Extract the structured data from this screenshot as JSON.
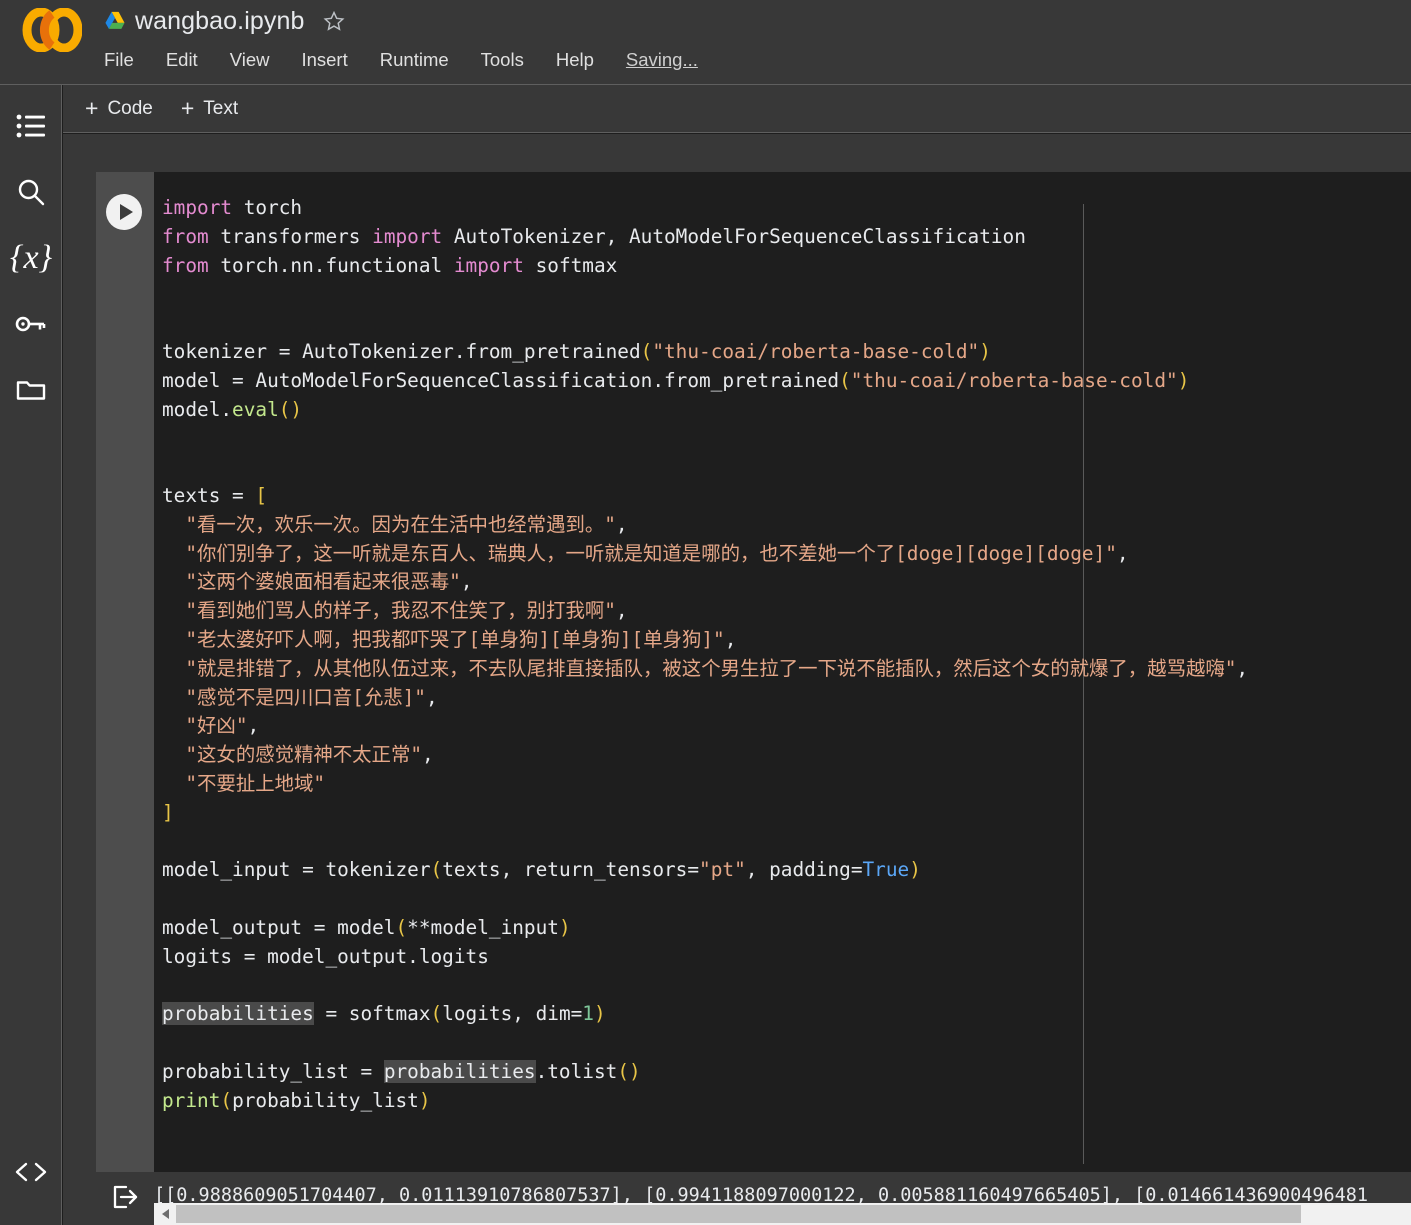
{
  "header": {
    "logo": "colab-logo",
    "drive_icon": "google-drive-icon",
    "notebook_title": "wangbao.ipynb",
    "star_icon": "star-icon",
    "menus": [
      "File",
      "Edit",
      "View",
      "Insert",
      "Runtime",
      "Tools",
      "Help"
    ],
    "save_status": "Saving..."
  },
  "rail": {
    "items": [
      {
        "name": "toc-icon",
        "label": "Table of contents"
      },
      {
        "name": "search-icon",
        "label": "Find and replace"
      },
      {
        "name": "variables-icon",
        "label": "{x}"
      },
      {
        "name": "key-icon",
        "label": "Secrets"
      },
      {
        "name": "folder-icon",
        "label": "Files"
      }
    ],
    "snippets_icon": "code-brackets-icon"
  },
  "toolbar": {
    "add_code_label": "Code",
    "add_text_label": "Text",
    "plus": "+"
  },
  "cell": {
    "run_icon": "run-play-icon",
    "output_icon": "output-arrow-icon",
    "code_lines": [
      {
        "type": "code",
        "tokens": [
          {
            "t": "import",
            "c": "kw"
          },
          {
            "t": " torch",
            "c": ""
          }
        ]
      },
      {
        "type": "code",
        "tokens": [
          {
            "t": "from",
            "c": "kw"
          },
          {
            "t": " transformers ",
            "c": ""
          },
          {
            "t": "import",
            "c": "kw"
          },
          {
            "t": " AutoTokenizer, AutoModelForSequenceClassification",
            "c": ""
          }
        ]
      },
      {
        "type": "code",
        "tokens": [
          {
            "t": "from",
            "c": "kw"
          },
          {
            "t": " torch.nn.functional ",
            "c": ""
          },
          {
            "t": "import",
            "c": "kw"
          },
          {
            "t": " softmax",
            "c": ""
          }
        ]
      },
      {
        "type": "blank",
        "tokens": []
      },
      {
        "type": "blank",
        "tokens": []
      },
      {
        "type": "code",
        "tokens": [
          {
            "t": "tokenizer = AutoTokenizer.from_pretrained",
            "c": ""
          },
          {
            "t": "(",
            "c": "par"
          },
          {
            "t": "\"thu-coai/roberta-base-cold\"",
            "c": "str"
          },
          {
            "t": ")",
            "c": "par"
          }
        ]
      },
      {
        "type": "code",
        "tokens": [
          {
            "t": "model = AutoModelForSequenceClassification.from_pretrained",
            "c": ""
          },
          {
            "t": "(",
            "c": "par"
          },
          {
            "t": "\"thu-coai/roberta-base-cold\"",
            "c": "str"
          },
          {
            "t": ")",
            "c": "par"
          }
        ]
      },
      {
        "type": "code",
        "tokens": [
          {
            "t": "model.",
            "c": ""
          },
          {
            "t": "eval",
            "c": "fn"
          },
          {
            "t": "()",
            "c": "par"
          }
        ]
      },
      {
        "type": "blank",
        "tokens": []
      },
      {
        "type": "blank",
        "tokens": []
      },
      {
        "type": "code",
        "tokens": [
          {
            "t": "texts = ",
            "c": ""
          },
          {
            "t": "[",
            "c": "par"
          }
        ]
      },
      {
        "type": "code",
        "tokens": [
          {
            "t": "  ",
            "c": ""
          },
          {
            "t": "\"看一次，欢乐一次。因为在生活中也经常遇到。\"",
            "c": "str"
          },
          {
            "t": ",",
            "c": ""
          }
        ]
      },
      {
        "type": "code",
        "tokens": [
          {
            "t": "  ",
            "c": ""
          },
          {
            "t": "\"你们别争了，这一听就是东百人、瑞典人，一听就是知道是哪的，也不差她一个了[doge][doge][doge]\"",
            "c": "str"
          },
          {
            "t": ",",
            "c": ""
          }
        ]
      },
      {
        "type": "code",
        "tokens": [
          {
            "t": "  ",
            "c": ""
          },
          {
            "t": "\"这两个婆娘面相看起来很恶毒\"",
            "c": "str"
          },
          {
            "t": ",",
            "c": ""
          }
        ]
      },
      {
        "type": "code",
        "tokens": [
          {
            "t": "  ",
            "c": ""
          },
          {
            "t": "\"看到她们骂人的样子，我忍不住笑了，别打我啊\"",
            "c": "str"
          },
          {
            "t": ",",
            "c": ""
          }
        ]
      },
      {
        "type": "code",
        "tokens": [
          {
            "t": "  ",
            "c": ""
          },
          {
            "t": "\"老太婆好吓人啊，把我都吓哭了[单身狗][单身狗][单身狗]\"",
            "c": "str"
          },
          {
            "t": ",",
            "c": ""
          }
        ]
      },
      {
        "type": "code",
        "tokens": [
          {
            "t": "  ",
            "c": ""
          },
          {
            "t": "\"就是排错了，从其他队伍过来，不去队尾排直接插队，被这个男生拉了一下说不能插队，然后这个女的就爆了，越骂越嗨\"",
            "c": "str"
          },
          {
            "t": ",",
            "c": ""
          }
        ]
      },
      {
        "type": "code",
        "tokens": [
          {
            "t": "  ",
            "c": ""
          },
          {
            "t": "\"感觉不是四川口音[允悲]\"",
            "c": "str"
          },
          {
            "t": ",",
            "c": ""
          }
        ]
      },
      {
        "type": "code",
        "tokens": [
          {
            "t": "  ",
            "c": ""
          },
          {
            "t": "\"好凶\"",
            "c": "str"
          },
          {
            "t": ",",
            "c": ""
          }
        ]
      },
      {
        "type": "code",
        "tokens": [
          {
            "t": "  ",
            "c": ""
          },
          {
            "t": "\"这女的感觉精神不太正常\"",
            "c": "str"
          },
          {
            "t": ",",
            "c": ""
          }
        ]
      },
      {
        "type": "code",
        "tokens": [
          {
            "t": "  ",
            "c": ""
          },
          {
            "t": "\"不要扯上地域\"",
            "c": "str"
          }
        ]
      },
      {
        "type": "code",
        "tokens": [
          {
            "t": "]",
            "c": "par"
          }
        ]
      },
      {
        "type": "blank",
        "tokens": []
      },
      {
        "type": "code",
        "tokens": [
          {
            "t": "model_input = tokenizer",
            "c": ""
          },
          {
            "t": "(",
            "c": "par"
          },
          {
            "t": "texts, return_tensors=",
            "c": ""
          },
          {
            "t": "\"pt\"",
            "c": "str"
          },
          {
            "t": ", padding=",
            "c": ""
          },
          {
            "t": "True",
            "c": "bool"
          },
          {
            "t": ")",
            "c": "par"
          }
        ]
      },
      {
        "type": "blank",
        "tokens": []
      },
      {
        "type": "code",
        "tokens": [
          {
            "t": "model_output = model",
            "c": ""
          },
          {
            "t": "(",
            "c": "par"
          },
          {
            "t": "**model_input",
            "c": ""
          },
          {
            "t": ")",
            "c": "par"
          }
        ]
      },
      {
        "type": "code",
        "tokens": [
          {
            "t": "logits = model_output.logits",
            "c": ""
          }
        ]
      },
      {
        "type": "blank",
        "tokens": []
      },
      {
        "type": "code",
        "tokens": [
          {
            "t": "probabilities",
            "c": "hl"
          },
          {
            "t": " = softmax",
            "c": ""
          },
          {
            "t": "(",
            "c": "par"
          },
          {
            "t": "logits, dim=",
            "c": ""
          },
          {
            "t": "1",
            "c": "num"
          },
          {
            "t": ")",
            "c": "par"
          }
        ]
      },
      {
        "type": "blank",
        "tokens": []
      },
      {
        "type": "code",
        "tokens": [
          {
            "t": "probability_list = ",
            "c": ""
          },
          {
            "t": "probabilities",
            "c": "hl"
          },
          {
            "t": ".tolist",
            "c": ""
          },
          {
            "t": "()",
            "c": "par"
          }
        ]
      },
      {
        "type": "code",
        "tokens": [
          {
            "t": "print",
            "c": "fn"
          },
          {
            "t": "(",
            "c": "par"
          },
          {
            "t": "probability_list",
            "c": ""
          },
          {
            "t": ")",
            "c": "par"
          }
        ]
      }
    ],
    "output_text": "[[0.9888609051704407, 0.01113910786807537], [0.9941188097000122, 0.005881160497665405], [0.014661436900496481"
  }
}
